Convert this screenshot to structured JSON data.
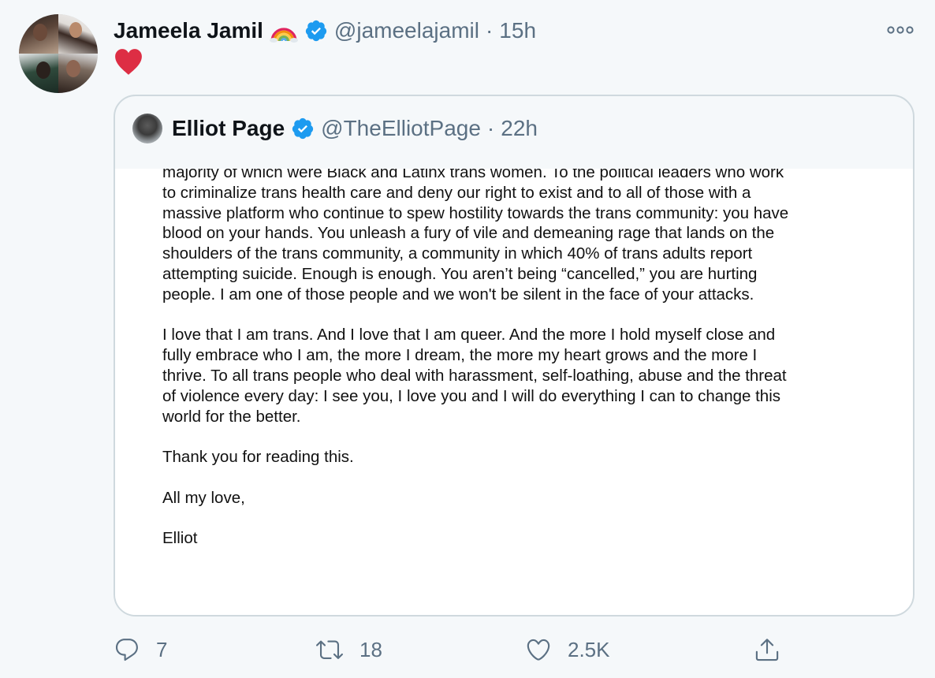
{
  "tweet": {
    "author": {
      "name": "Jameela Jamil",
      "handle": "@jameelajamil",
      "time": "15h",
      "separator": "·",
      "emoji_icon": "rainbow-icon",
      "verified_icon": "verified-badge-icon"
    },
    "body_icon": "red-heart-icon",
    "more_icon": "more-options-icon"
  },
  "quote": {
    "author": {
      "name": "Elliot Page",
      "handle": "@TheElliotPage",
      "time": "22h",
      "separator": "·"
    },
    "image_text": {
      "p1": [
        "majority of which were Black and Latinx trans women. To the political leaders who work",
        "to criminalize trans health care and deny our right to exist and to all of those with a",
        "massive platform who continue to spew hostility towards the trans community: you have",
        "blood on your hands. You unleash a fury of vile and demeaning rage that lands on the",
        "shoulders of the trans community, a community in which 40% of trans adults report",
        "attempting suicide. Enough is enough. You aren’t being “cancelled,” you are hurting",
        "people. I am one of those people and we won't be silent in the face of your attacks."
      ],
      "p2": [
        "I love that I am trans. And I love that I am queer. And the more I hold myself close and",
        "fully embrace who I am, the more I dream, the more my heart grows and the more I",
        "thrive. To all trans people who deal with harassment, self-loathing, abuse and the threat",
        "of violence every day: I see you, I love you and I will do everything I can to change this",
        "world for the better."
      ],
      "p3": "Thank you for reading this.",
      "p4": "All my love,",
      "p5": "Elliot"
    }
  },
  "actions": {
    "reply": {
      "icon": "reply-icon",
      "count": "7"
    },
    "retweet": {
      "icon": "retweet-icon",
      "count": "18"
    },
    "like": {
      "icon": "like-heart-icon",
      "count": "2.5K"
    },
    "share": {
      "icon": "share-icon"
    }
  },
  "colors": {
    "background": "#f5f8fa",
    "text_primary": "#0f1419",
    "text_secondary": "#5b7083",
    "verified": "#1d9bf0",
    "heart": "#e0245e",
    "card_border": "#cfd9de"
  }
}
